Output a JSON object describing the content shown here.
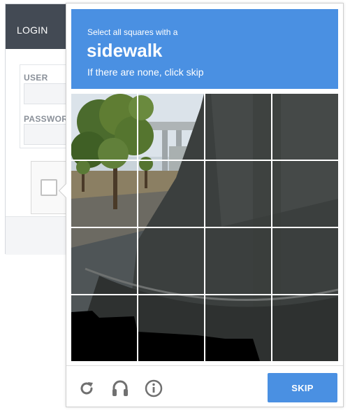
{
  "login": {
    "title": "LOGIN",
    "user_label": "USER",
    "password_label": "PASSWORD"
  },
  "challenge": {
    "instruction_top": "Select all squares with a",
    "target": "sidewalk",
    "instruction_bottom": "If there are none, click skip",
    "grid_rows": 4,
    "grid_cols": 4,
    "skip_label": "SKIP",
    "accent_color": "#4a90e2"
  },
  "controls": {
    "reload_icon": "reload-icon",
    "audio_icon": "headphones-icon",
    "info_icon": "info-icon"
  }
}
